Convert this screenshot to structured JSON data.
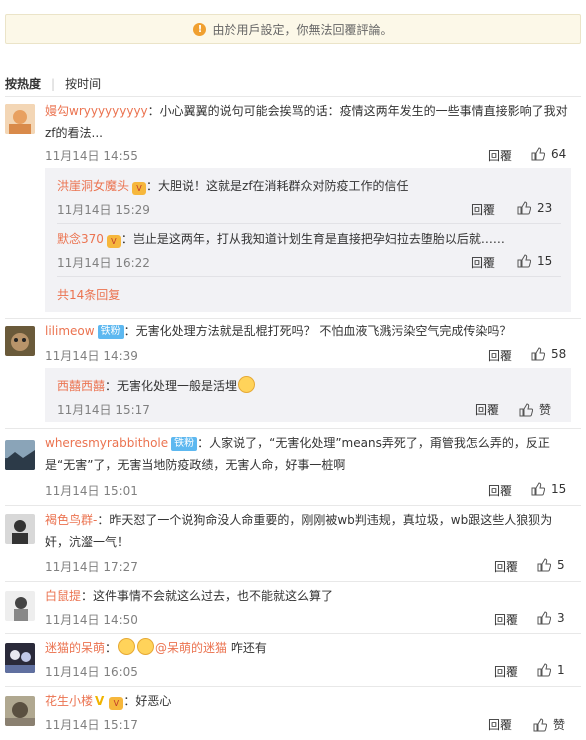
{
  "notice": "由於用戶設定，你無法回覆評論。",
  "sort": {
    "hot": "按热度",
    "time": "按时间"
  },
  "labels": {
    "reply": "回覆"
  },
  "comments": [
    {
      "user": "嫚勾wryyyyyyyyy",
      "text": "：小心翼翼的说句可能会挨骂的话：疫情这两年发生的一些事情直接影响了我对zf的看法...",
      "time": "11月14日 14:55",
      "likes": "64"
    },
    {
      "user": "lilimeow",
      "badge": "铁粉",
      "text": "：无害化处理方法就是乱棍打死吗？ 不怕血液飞溅污染空气完成传染吗？",
      "time": "11月14日 14:39",
      "likes": "58"
    },
    {
      "user": "wheresmyrabbithole",
      "badge": "铁粉",
      "text": "：人家说了，“无害化处理”means弄死了，甭管我怎么弄的，反正是“无害”了，无害当地防疫政绩，无害人命，好事一桩啊",
      "time": "11月14日 15:01",
      "likes": "15"
    },
    {
      "user": "褐色鸟群-",
      "text": "：昨天怼了一个说狗命没人命重要的，刚刚被wb判违规，真垃圾，wb跟这些人狼狈为奸，沆瀣一气！",
      "time": "11月14日 17:27",
      "likes": "5"
    },
    {
      "user": "白鼠提",
      "text": "：这件事情不会就这么过去，也不能就这么算了",
      "time": "11月14日 14:50",
      "likes": "3"
    },
    {
      "user": "迷猫的呆萌",
      "text_pre": "：",
      "mention": "@呆萌的迷猫",
      "text_post": " 咋还有",
      "time": "11月14日 16:05",
      "likes": "1"
    },
    {
      "user": "花生小楼",
      "text": "：好恶心",
      "time": "11月14日 15:17",
      "likes": "赞"
    }
  ],
  "replies1": [
    {
      "user": "洪崖洞女魔头",
      "text": "：大胆说！这就是zf在消耗群众对防疫工作的信任",
      "time": "11月14日 15:29",
      "likes": "23"
    },
    {
      "user": "默念370",
      "text": "：岂止是这两年，打从我知道计划生育是直接把孕妇拉去堕胎以后就……",
      "time": "11月14日 16:22",
      "likes": "15"
    }
  ],
  "more1": "共14条回复",
  "replies2": [
    {
      "user": "西囍西囍",
      "text": "：无害化处理一般是活埋",
      "time": "11月14日 15:17",
      "likes": "赞"
    }
  ]
}
